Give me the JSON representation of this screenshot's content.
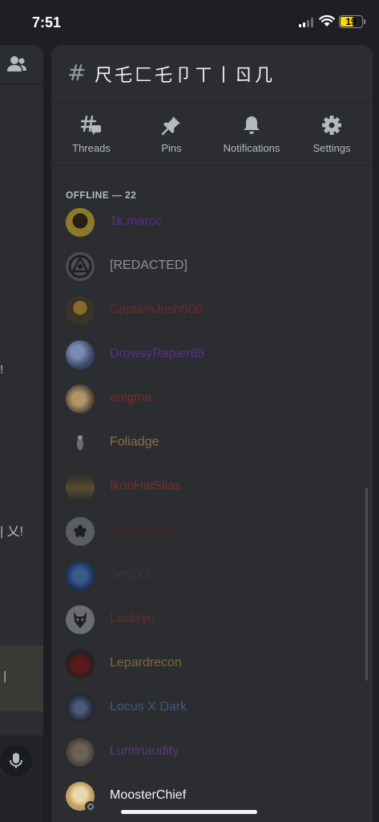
{
  "status_bar": {
    "time": "7:51",
    "battery": "19",
    "icons": [
      "signal-icon",
      "wifi-icon",
      "battery-icon"
    ]
  },
  "background_pane": {
    "fragments": [
      "!",
      "| 乂!",
      "᠋ |"
    ],
    "icons": [
      "members-icon",
      "microphone-icon"
    ]
  },
  "channel": {
    "hash": "#",
    "name": "尺乇匚乇卩ㄒ丨ㄖ几"
  },
  "actions": [
    {
      "label": "Threads",
      "icon": "threads-icon"
    },
    {
      "label": "Pins",
      "icon": "pin-icon"
    },
    {
      "label": "Notifications",
      "icon": "bell-icon"
    },
    {
      "label": "Settings",
      "icon": "gear-icon"
    }
  ],
  "members_section": {
    "header": "OFFLINE — 22",
    "members": [
      {
        "name": "1k.marcc",
        "color": "#5a2f8a"
      },
      {
        "name": "[REDACTED]",
        "color": "#8e9297"
      },
      {
        "name": "CaptainJosh500",
        "color": "#6a2a2a"
      },
      {
        "name": "DrowsyRapier85",
        "color": "#5a2f8a"
      },
      {
        "name": "enigma",
        "color": "#7a2c2c"
      },
      {
        "name": "Foliadge",
        "color": "#8a6e4a"
      },
      {
        "name": "IkonHaiSilas",
        "color": "#7a2c2c"
      },
      {
        "name": "Innoweaver",
        "color": "#4a2222"
      },
      {
        "name": "Jen2k1",
        "color": "#36383c"
      },
      {
        "name": "Lackryn",
        "color": "#6a2a2a"
      },
      {
        "name": "Lepardrecon",
        "color": "#7a6a35"
      },
      {
        "name": "Locus X Dark",
        "color": "#3c5a80"
      },
      {
        "name": "Luminaudity",
        "color": "#5a3a7a"
      },
      {
        "name": "MoosterChief",
        "color": "#f2f3f5"
      }
    ]
  }
}
